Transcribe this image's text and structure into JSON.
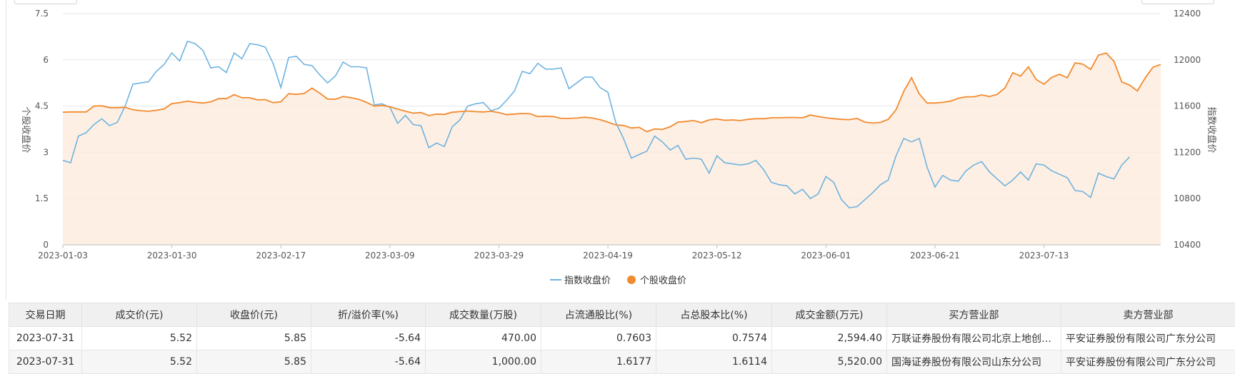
{
  "chart_data": {
    "type": "line",
    "legend_position": "bottom-center",
    "grid": true,
    "y_left": {
      "label": "个股收盘价",
      "range": [
        0,
        7.5
      ],
      "ticks": [
        "0",
        "1.5",
        "3",
        "4.5",
        "6",
        "7.5"
      ]
    },
    "y_right": {
      "label": "指数收盘价",
      "range": [
        10400,
        12400
      ],
      "ticks": [
        "10400",
        "10800",
        "11200",
        "11600",
        "12000",
        "12400"
      ]
    },
    "x_ticks": [
      "2023-01-03",
      "2023-01-30",
      "2023-02-17",
      "2023-03-09",
      "2023-03-29",
      "2023-04-19",
      "2023-05-12",
      "2023-06-01",
      "2023-06-21",
      "2023-07-13"
    ],
    "x_tick_positions": [
      0,
      14,
      28,
      42,
      56,
      70,
      84,
      98,
      112,
      126
    ],
    "series": [
      {
        "name": "指数收盘价",
        "axis": "right",
        "color": "#6fb3e0",
        "values": [
          11130,
          11110,
          11340,
          11370,
          11440,
          11490,
          11430,
          11460,
          11600,
          11790,
          11800,
          11810,
          11900,
          11960,
          12060,
          11990,
          12160,
          12140,
          12080,
          11930,
          11940,
          11890,
          12060,
          12010,
          12140,
          12130,
          12110,
          11970,
          11760,
          12020,
          12030,
          11960,
          11950,
          11870,
          11800,
          11860,
          11980,
          11940,
          11940,
          11930,
          11610,
          11620,
          11590,
          11450,
          11520,
          11440,
          11430,
          11240,
          11280,
          11250,
          11420,
          11480,
          11600,
          11620,
          11630,
          11560,
          11580,
          11650,
          11730,
          11900,
          11880,
          11970,
          11920,
          11920,
          11930,
          11750,
          11800,
          11850,
          11850,
          11760,
          11720,
          11460,
          11320,
          11150,
          11180,
          11210,
          11340,
          11290,
          11220,
          11260,
          11140,
          11150,
          11140,
          11020,
          11170,
          11110,
          11100,
          11090,
          11100,
          11130,
          11050,
          10940,
          10920,
          10910,
          10840,
          10880,
          10800,
          10840,
          10990,
          10940,
          10790,
          10720,
          10730,
          10790,
          10850,
          10920,
          10960,
          11170,
          11320,
          11290,
          11320,
          11070,
          10900,
          11000,
          10960,
          10950,
          11040,
          11090,
          11120,
          11030,
          10970,
          10910,
          10960,
          11030,
          10960,
          11100,
          11090,
          11040,
          11010,
          10980,
          10870,
          10860,
          10810,
          11020,
          10990,
          10970,
          11090,
          11160
        ]
      },
      {
        "name": "个股收盘价",
        "axis": "left",
        "color": "#f28a2e",
        "values": [
          4.3,
          4.31,
          4.31,
          4.31,
          4.5,
          4.51,
          4.45,
          4.45,
          4.46,
          4.38,
          4.35,
          4.33,
          4.36,
          4.41,
          4.58,
          4.61,
          4.66,
          4.62,
          4.6,
          4.64,
          4.74,
          4.74,
          4.87,
          4.77,
          4.77,
          4.7,
          4.71,
          4.61,
          4.64,
          4.9,
          4.88,
          4.91,
          5.08,
          4.92,
          4.73,
          4.72,
          4.81,
          4.77,
          4.72,
          4.62,
          4.5,
          4.52,
          4.48,
          4.4,
          4.33,
          4.27,
          4.29,
          4.19,
          4.24,
          4.23,
          4.3,
          4.32,
          4.34,
          4.32,
          4.31,
          4.33,
          4.29,
          4.22,
          4.24,
          4.26,
          4.25,
          4.16,
          4.17,
          4.16,
          4.1,
          4.1,
          4.11,
          4.14,
          4.11,
          4.06,
          3.98,
          3.89,
          3.87,
          3.79,
          3.81,
          3.67,
          3.76,
          3.74,
          3.83,
          3.98,
          4.0,
          4.03,
          3.96,
          4.05,
          4.08,
          4.04,
          4.05,
          4.03,
          4.07,
          4.09,
          4.09,
          4.12,
          4.12,
          4.13,
          4.13,
          4.12,
          4.21,
          4.16,
          4.12,
          4.09,
          4.07,
          4.06,
          4.1,
          3.98,
          3.95,
          3.97,
          4.07,
          4.38,
          4.98,
          5.42,
          4.89,
          4.6,
          4.6,
          4.62,
          4.66,
          4.75,
          4.8,
          4.8,
          4.86,
          4.81,
          4.88,
          5.09,
          5.58,
          5.47,
          5.77,
          5.36,
          5.21,
          5.43,
          5.53,
          5.42,
          5.9,
          5.86,
          5.69,
          6.15,
          6.22,
          5.95,
          5.28,
          5.18,
          4.99,
          5.41,
          5.76,
          5.85
        ]
      }
    ]
  },
  "table": {
    "headers": [
      "交易日期",
      "成交价(元)",
      "收盘价(元)",
      "折/溢价率(%)",
      "成交数量(万股)",
      "占流通股比(%)",
      "占总股本比(%)",
      "成交金额(万元)",
      "买方营业部",
      "卖方营业部"
    ],
    "rows": [
      [
        "2023-07-31",
        "5.52",
        "5.85",
        "-5.64",
        "470.00",
        "0.7603",
        "0.7574",
        "2,594.40",
        "万联证券股份有限公司北京上地创新中心证券营业部",
        "平安证券股份有限公司广东分公司"
      ],
      [
        "2023-07-31",
        "5.52",
        "5.85",
        "-5.64",
        "1,000.00",
        "1.6177",
        "1.6114",
        "5,520.00",
        "国海证券股份有限公司山东分公司",
        "平安证券股份有限公司广东分公司"
      ]
    ]
  }
}
